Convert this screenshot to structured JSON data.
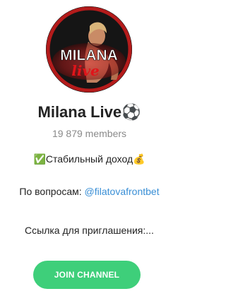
{
  "channel": {
    "name": "Milana Live⚽",
    "members": "19 879 members",
    "avatar_text": "MILANA",
    "avatar_script_text": "live"
  },
  "description": {
    "line1": "✅Стабильный доход💰",
    "line2_prefix": "По вопросам: ",
    "line2_link": "@filatovafrontbet",
    "line3": "Ссылка для приглашения:..."
  },
  "actions": {
    "join_label": "JOIN CHANNEL"
  },
  "colors": {
    "join_button": "#3ecf7a",
    "link": "#3a8fd6",
    "muted": "#8a8a8a"
  }
}
